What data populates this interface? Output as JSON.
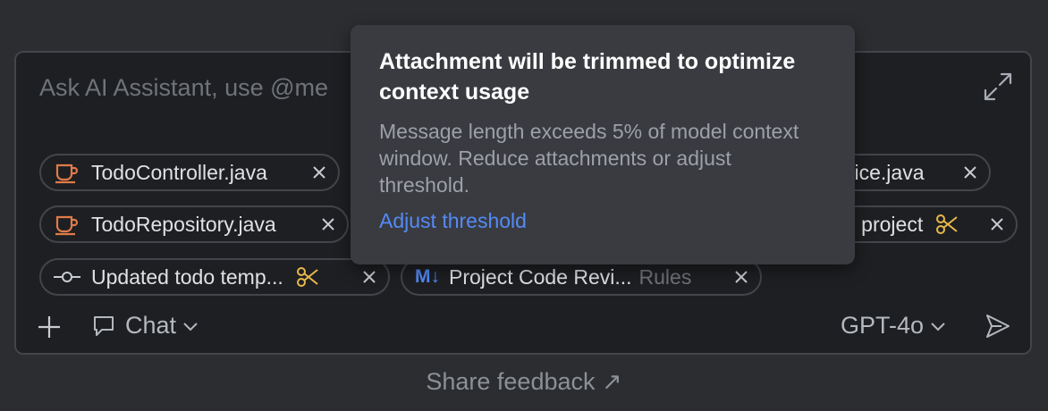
{
  "input": {
    "placeholder": "Ask AI Assistant, use @me"
  },
  "attachments": [
    {
      "label": "TodoController.java",
      "icon": "java-cup-icon"
    },
    {
      "label": "vice.java",
      "icon": "java-cup-icon"
    },
    {
      "label": "TodoRepository.java",
      "icon": "java-cup-icon"
    },
    {
      "label": "e project",
      "icon": "scissors-icon"
    },
    {
      "label": "Updated todo temp...",
      "icon": "commit-icon"
    },
    {
      "label": "Project Code Revi...",
      "sublabel": "Rules",
      "icon": "markdown-icon",
      "badge": "M↓"
    }
  ],
  "toolbar": {
    "add_label": "+",
    "mode_label": "Chat",
    "model_label": "GPT-4o"
  },
  "footer": {
    "feedback_label": "Share feedback ↗"
  },
  "popup": {
    "title": "Attachment will be trimmed to optimize context usage",
    "body": "Message length exceeds 5% of model context window. Reduce attachments or adjust threshold.",
    "link": "Adjust threshold"
  },
  "colors": {
    "java_icon": "#e07b4a",
    "scissors": "#e8b84a",
    "link": "#548af7",
    "markdown_badge": "#548af7"
  }
}
